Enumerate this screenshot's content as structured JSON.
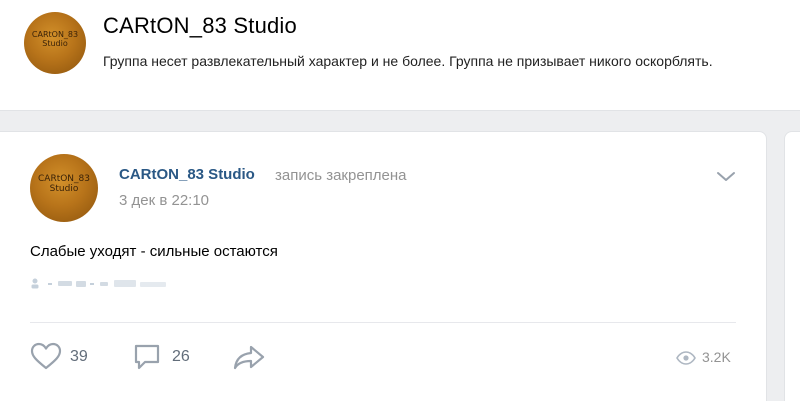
{
  "group": {
    "name": "CARtON_83 Studio",
    "status": "Группа несет развлекательный характер и не более. Группа не призывает никого оскорблять.",
    "avatar_text_line1": "CARtON_83",
    "avatar_text_line2": "Studio"
  },
  "post": {
    "author": "CARtON_83 Studio",
    "pinned_label": "запись закреплена",
    "date": "3 дек в 22:10",
    "text": "Слабые уходят - сильные остаются",
    "avatar_text_line1": "CARtON_83",
    "avatar_text_line2": "Studio",
    "actions": {
      "likes": "39",
      "comments": "26",
      "views": "3.2K"
    }
  },
  "icons": {
    "like": "heart-icon",
    "comment": "comment-icon",
    "share": "share-arrow-icon",
    "views": "eye-icon",
    "more": "chevron-down-icon",
    "signature": "person-icon"
  },
  "colors": {
    "background": "#edeef0",
    "card": "#ffffff",
    "author_link": "#2a5885",
    "muted_text": "#939393",
    "action_icon": "#99a2ad"
  }
}
